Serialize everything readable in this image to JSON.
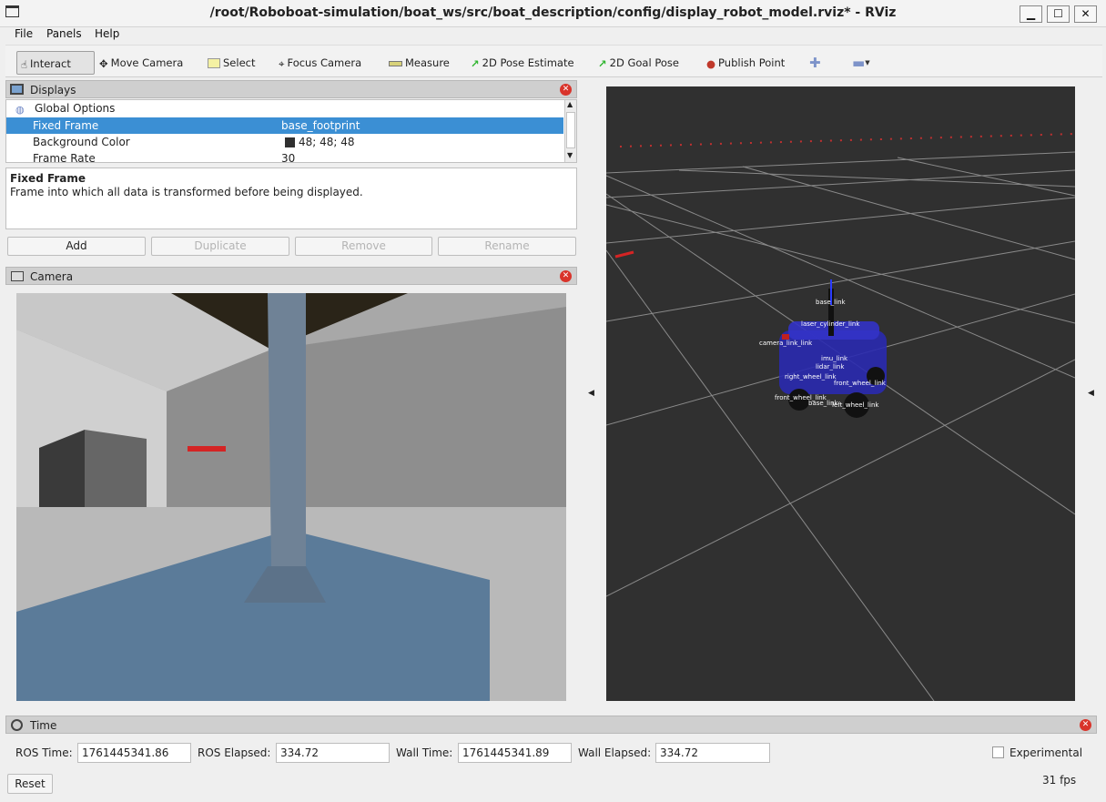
{
  "window": {
    "title": "/root/Roboboat-simulation/boat_ws/src/boat_description/config/display_robot_model.rviz* - RViz"
  },
  "menu": [
    "File",
    "Panels",
    "Help"
  ],
  "toolbar": {
    "interact": "Interact",
    "move_camera": "Move Camera",
    "select": "Select",
    "focus_camera": "Focus Camera",
    "measure": "Measure",
    "pose_estimate": "2D Pose Estimate",
    "goal_pose": "2D Goal Pose",
    "publish_point": "Publish Point"
  },
  "displays": {
    "title": "Displays",
    "rows": [
      {
        "name": "Global Options",
        "value": ""
      },
      {
        "name": "Fixed Frame",
        "value": "base_footprint"
      },
      {
        "name": "Background Color",
        "value": "48; 48; 48"
      },
      {
        "name": "Frame Rate",
        "value": "30"
      }
    ],
    "desc_title": "Fixed Frame",
    "desc_text": "Frame into which all data is transformed before being displayed.",
    "buttons": [
      "Add",
      "Duplicate",
      "Remove",
      "Rename"
    ]
  },
  "camera_panel": {
    "title": "Camera"
  },
  "scene_labels": [
    "base_link",
    "laser_cylinder_link",
    "camera_link_link",
    "imu_link",
    "lidar_link",
    "right_wheel_link",
    "front_wheel_link",
    "front_wheel_link",
    "base_link",
    "left_wheel_link"
  ],
  "time": {
    "title": "Time",
    "ros_time_label": "ROS Time:",
    "ros_time": "1761445341.86",
    "ros_elapsed_label": "ROS Elapsed:",
    "ros_elapsed": "334.72",
    "wall_time_label": "Wall Time:",
    "wall_time": "1761445341.89",
    "wall_elapsed_label": "Wall Elapsed:",
    "wall_elapsed": "334.72",
    "experimental": "Experimental",
    "reset": "Reset",
    "fps": "31 fps"
  },
  "colors": {
    "background": "#303030",
    "selection": "#3b8fd4",
    "close": "#d9342b"
  }
}
